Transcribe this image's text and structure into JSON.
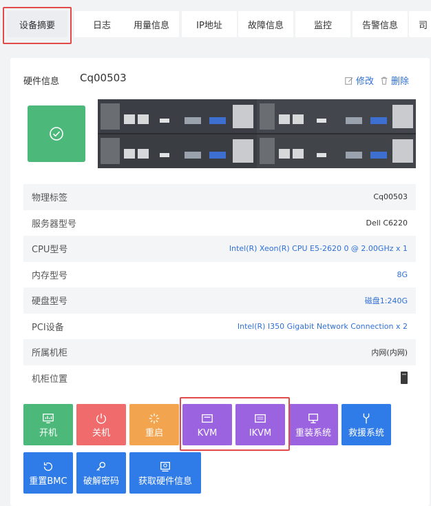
{
  "tabs": [
    "设备摘要",
    "日志",
    "用量信息",
    "IP地址",
    "故障信息",
    "监控",
    "告警信息",
    "司"
  ],
  "header": {
    "title": "硬件信息",
    "device_id": "Cq00503",
    "edit_label": "修改",
    "delete_label": "删除"
  },
  "info_rows": [
    {
      "label": "物理标签",
      "value": "Cq00503"
    },
    {
      "label": "服务器型号",
      "value": "Dell C6220"
    },
    {
      "label": "CPU型号",
      "value": "Intel(R) Xeon(R) CPU E5-2620 0 @ 2.00GHz x 1"
    },
    {
      "label": "内存型号",
      "value": "8G"
    },
    {
      "label": "硬盘型号",
      "value": "磁盘1:240G"
    },
    {
      "label": "PCI设备",
      "value": "Intel(R) I350 Gigabit Network Connection x 2"
    },
    {
      "label": "所属机柜",
      "value": "内网(内网)"
    },
    {
      "label": "机柜位置",
      "value": ""
    }
  ],
  "buttons": {
    "power_on": "开机",
    "power_off": "关机",
    "reboot": "重启",
    "kvm": "KVM",
    "ikvm": "IKVM",
    "reinstall": "重装系统",
    "rescue": "救援系统",
    "reset_bmc": "重置BMC",
    "crack_password": "破解密码",
    "get_hardware": "获取硬件信息"
  },
  "colors": {
    "green": "#4cb87a",
    "red": "#f06b6b",
    "orange": "#f2a54e",
    "purple": "#9c63e0",
    "blue": "#2f7be8",
    "link": "#2f6fd6",
    "highlight": "#e24a4a"
  }
}
